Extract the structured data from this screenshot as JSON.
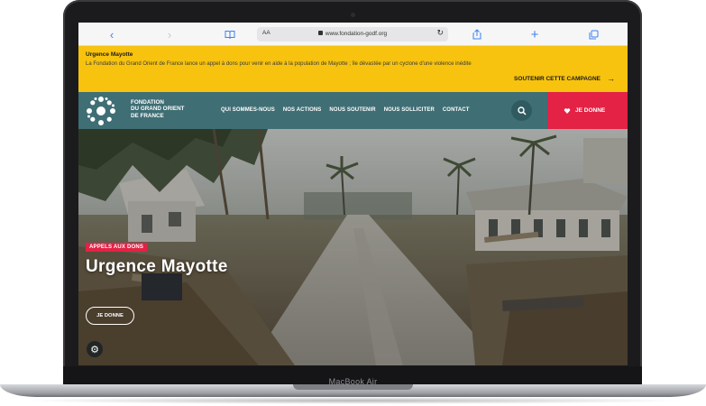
{
  "browser": {
    "url": "www.fondation-godf.org",
    "aa_label": "AA"
  },
  "banner": {
    "title": "Urgence Mayotte",
    "text": "La Fondation du Grand Orient de France lance un appel à dons pour venir en aide à la population de Mayotte ; île dévastée par un cyclone d'une violence inédite",
    "cta_label": "SOUTENIR CETTE CAMPAGNE"
  },
  "nav": {
    "logo_text": [
      "FONDATION",
      "DU GRAND ORIENT",
      "DE FRANCE"
    ],
    "items": [
      {
        "label": "QUI SOMMES-NOUS"
      },
      {
        "label": "NOS ACTIONS"
      },
      {
        "label": "NOUS SOUTENIR"
      },
      {
        "label": "NOUS SOLLICITER"
      },
      {
        "label": "CONTACT"
      }
    ],
    "donate_label": "JE DONNE"
  },
  "hero": {
    "badge": "APPELS AUX DONS",
    "title": "Urgence Mayotte",
    "button_label": "JE DONNE"
  },
  "device": {
    "model_label": "MacBook Air"
  },
  "colors": {
    "banner": "#f7c30f",
    "nav": "#3f6e75",
    "donate": "#e32245",
    "browser_accent": "#3b82f6"
  }
}
